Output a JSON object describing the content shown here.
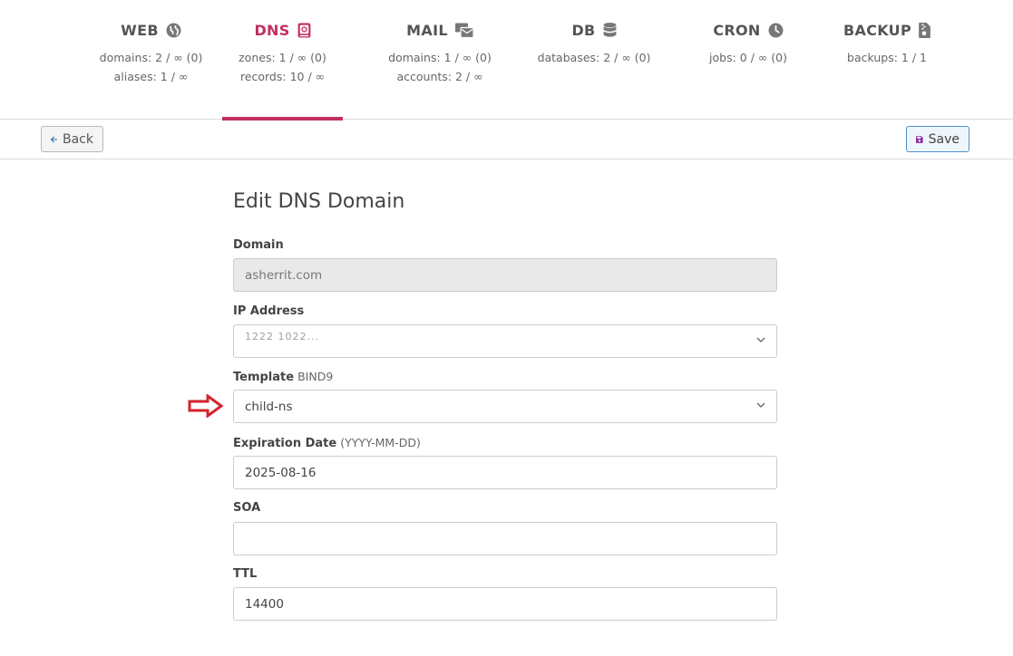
{
  "nav": {
    "tabs": [
      {
        "title": "WEB",
        "icon": "globe-icon",
        "stats": [
          "domains: 2 / ∞ (0)",
          "aliases: 1 / ∞"
        ]
      },
      {
        "title": "DNS",
        "icon": "dns-book-icon",
        "stats": [
          "zones: 1 / ∞ (0)",
          "records: 10 / ∞"
        ],
        "active": true
      },
      {
        "title": "MAIL",
        "icon": "mail-icon",
        "stats": [
          "domains: 1 / ∞ (0)",
          "accounts: 2 / ∞"
        ]
      },
      {
        "title": "DB",
        "icon": "database-icon",
        "stats": [
          "databases: 2 / ∞ (0)"
        ]
      },
      {
        "title": "CRON",
        "icon": "clock-icon",
        "stats": [
          "jobs: 0 / ∞ (0)"
        ]
      },
      {
        "title": "BACKUP",
        "icon": "file-archive-icon",
        "stats": [
          "backups: 1 / 1"
        ]
      }
    ]
  },
  "toolbar": {
    "back_label": "Back",
    "save_label": "Save"
  },
  "form": {
    "title": "Edit DNS Domain",
    "domain": {
      "label": "Domain",
      "value": "asherrit.com"
    },
    "ip": {
      "label": "IP Address",
      "value": "1222 1022..."
    },
    "template": {
      "label": "Template",
      "hint": "BIND9",
      "value": "child-ns"
    },
    "expiration": {
      "label": "Expiration Date",
      "hint": "(YYYY-MM-DD)",
      "value": "2025-08-16"
    },
    "soa": {
      "label": "SOA",
      "value": ""
    },
    "ttl": {
      "label": "TTL",
      "value": "14400"
    }
  },
  "colors": {
    "accent": "#c22f5e",
    "save_border": "#4e8fc9",
    "save_icon": "#8e2aa3",
    "arrow": "#d3242b"
  }
}
